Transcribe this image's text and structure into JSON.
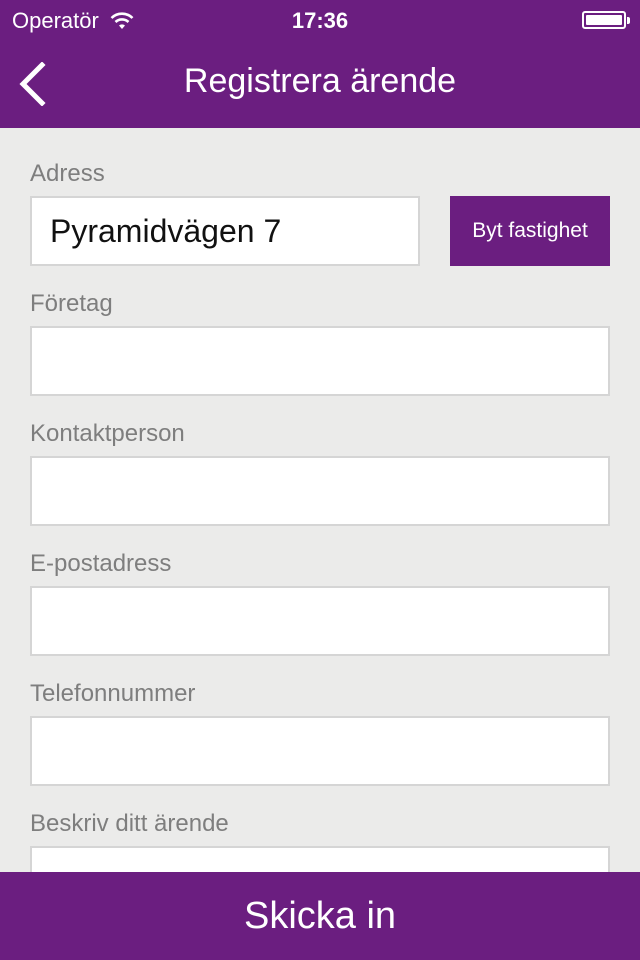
{
  "status_bar": {
    "carrier": "Operatör",
    "time": "17:36",
    "wifi_icon": "wifi-icon",
    "battery_icon": "battery-icon"
  },
  "nav": {
    "back_icon": "chevron-left-icon",
    "title": "Registrera ärende"
  },
  "form": {
    "address": {
      "label": "Adress",
      "value": "Pyramidvägen 7",
      "change_button": "Byt fastighet"
    },
    "company": {
      "label": "Företag",
      "value": ""
    },
    "contact_person": {
      "label": "Kontaktperson",
      "value": ""
    },
    "email": {
      "label": "E-postadress",
      "value": ""
    },
    "phone": {
      "label": "Telefonnummer",
      "value": ""
    },
    "description": {
      "label": "Beskriv ditt ärende",
      "value": ""
    }
  },
  "submit_label": "Skicka in",
  "colors": {
    "brand": "#6b1e80",
    "background": "#ebebea",
    "label": "#7e7e7e",
    "field_border": "#d5d5d5"
  }
}
